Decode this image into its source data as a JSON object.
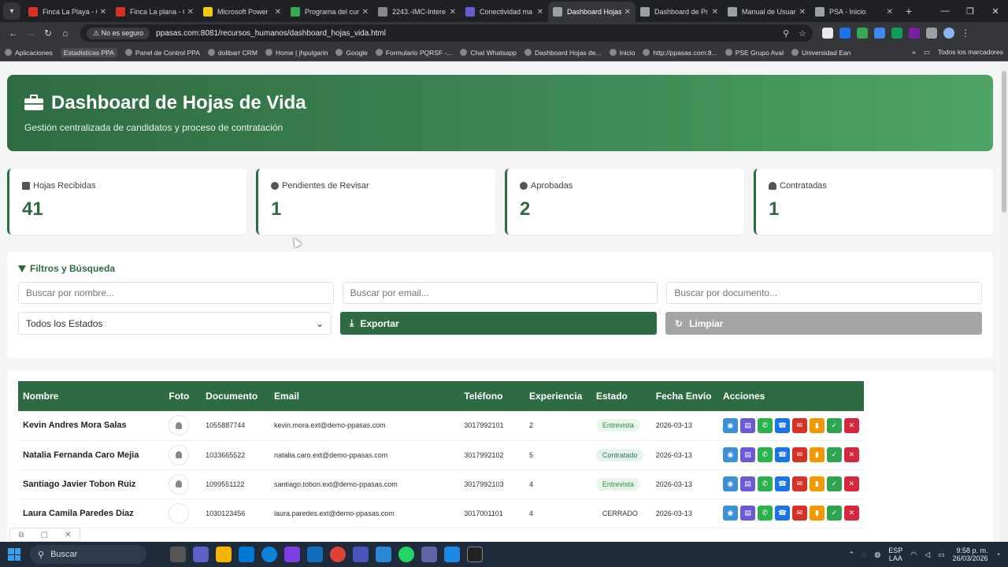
{
  "browser": {
    "tabs": [
      {
        "label": "Finca La Playa - G",
        "color": "#d93025"
      },
      {
        "label": "Finca La plana - G",
        "color": "#d93025"
      },
      {
        "label": "Microsoft Power",
        "color": "#f2c811"
      },
      {
        "label": "Programa del cur",
        "color": "#34a853"
      },
      {
        "label": "2243.-IMC-Intere",
        "color": "#888888"
      },
      {
        "label": "Conectividad ma",
        "color": "#6b5bd6"
      },
      {
        "label": "Dashboard Hojas",
        "color": "#9aa0a6",
        "active": true
      },
      {
        "label": "Dashboard de Pr",
        "color": "#9aa0a6"
      },
      {
        "label": "Manual de Usuari",
        "color": "#9aa0a6"
      },
      {
        "label": "PSA - Inicio",
        "color": "#9aa0a6"
      }
    ],
    "security_label": "No es seguro",
    "url": "ppasas.com:8081/recursos_humanos/dashboard_hojas_vida.html",
    "bookmarks": [
      "Aplicaciones",
      "Estadisticas PPA",
      "Panel de Control PPA",
      "dolibarr CRM",
      "Home | jhpulgarin",
      "Google",
      "Formulario PQRSF -...",
      "Chat Whatsapp",
      "Dashboard Hojas de...",
      "Inicio",
      "http://ppasas.com:8...",
      "PSE Grupo Aval",
      "Universidad Ean"
    ],
    "bookmarks_right": "Todos los marcadores"
  },
  "hero": {
    "title": "Dashboard de Hojas de Vida",
    "subtitle": "Gestión centralizada de candidatos y proceso de contratación"
  },
  "stats": [
    {
      "label": "Hojas Recibidas",
      "value": "41",
      "icon": "document-icon"
    },
    {
      "label": "Pendientes de Revisar",
      "value": "1",
      "icon": "clock-icon"
    },
    {
      "label": "Aprobadas",
      "value": "2",
      "icon": "check-circle-icon"
    },
    {
      "label": "Contratadas",
      "value": "1",
      "icon": "user-check-icon"
    }
  ],
  "filters": {
    "title": "Filtros y Búsqueda",
    "name_placeholder": "Buscar por nombre...",
    "email_placeholder": "Buscar por email...",
    "doc_placeholder": "Buscar por documento...",
    "status_selected": "Todos los Estados",
    "export_label": "Exportar",
    "clear_label": "Limpiar"
  },
  "table": {
    "headers": [
      "Nombre",
      "Foto",
      "Documento",
      "Email",
      "Teléfono",
      "Experiencia",
      "Estado",
      "Fecha Envío",
      "Acciones"
    ],
    "rows": [
      {
        "name": "Kevin Andres Mora Salas",
        "photo": true,
        "doc": "1055887744",
        "email": "kevin.mora.ext@demo-ppasas.com",
        "phone": "3017992101",
        "exp": "2",
        "status": "Entrevista",
        "status_class": "entrevista",
        "date": "2026-03-13"
      },
      {
        "name": "Natalia Fernanda Caro Mejia",
        "photo": true,
        "doc": "1033665522",
        "email": "natalia.caro.ext@demo-ppasas.com",
        "phone": "3017992102",
        "exp": "5",
        "status": "Contratado",
        "status_class": "contratado",
        "date": "2026-03-13"
      },
      {
        "name": "Santiago Javier Tobon Ruiz",
        "photo": true,
        "doc": "1099551122",
        "email": "santiago.tobon.ext@demo-ppasas.com",
        "phone": "3017992103",
        "exp": "4",
        "status": "Entrevista",
        "status_class": "entrevista",
        "date": "2026-03-13"
      },
      {
        "name": "Laura Camila Paredes Diaz",
        "photo": false,
        "doc": "1030123456",
        "email": "laura.paredes.ext@demo-ppasas.com",
        "phone": "3017001101",
        "exp": "4",
        "status": "CERRADO",
        "status_class": "cerrado",
        "date": "2026-03-13"
      }
    ],
    "actions": [
      {
        "name": "view-icon",
        "color": "#3d8fd6",
        "glyph": "◉"
      },
      {
        "name": "document-icon",
        "color": "#6a5ad8",
        "glyph": "▤"
      },
      {
        "name": "whatsapp-icon",
        "color": "#2bb24c",
        "glyph": "✆"
      },
      {
        "name": "phone-icon",
        "color": "#1a73e8",
        "glyph": "☎"
      },
      {
        "name": "email-icon",
        "color": "#d93025",
        "glyph": "✉"
      },
      {
        "name": "folder-icon",
        "color": "#f29900",
        "glyph": "▮"
      },
      {
        "name": "approve-icon",
        "color": "#2ea44f",
        "glyph": "✓"
      },
      {
        "name": "reject-icon",
        "color": "#d7263d",
        "glyph": "✕"
      }
    ]
  },
  "taskbar": {
    "search_label": "Buscar",
    "lang_top": "ESP",
    "lang_bottom": "LAA",
    "time": "9:58 p. m.",
    "date": "26/03/2026"
  }
}
